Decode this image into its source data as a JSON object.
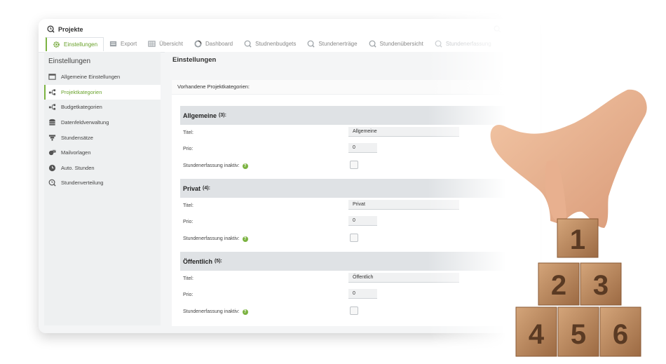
{
  "app": {
    "title": "Projekte"
  },
  "tabs": [
    {
      "label": "Einstellungen",
      "icon": "gear-icon",
      "active": true
    },
    {
      "label": "Export",
      "icon": "export-icon"
    },
    {
      "label": "Übersicht",
      "icon": "grid-icon"
    },
    {
      "label": "Dashboard",
      "icon": "dashboard-icon"
    },
    {
      "label": "Studnenbudgets",
      "icon": "clock-search-icon"
    },
    {
      "label": "Stundenerträge",
      "icon": "clock-search-icon"
    },
    {
      "label": "Stundenübersicht",
      "icon": "clock-search-icon"
    },
    {
      "label": "Stundenerfassung",
      "icon": "clock-search-icon"
    }
  ],
  "sidebar": {
    "title": "Einstellungen",
    "items": [
      {
        "label": "Allgemeine Einstellungen",
        "icon": "window-icon"
      },
      {
        "label": "Projektkategorien",
        "icon": "hierarchy-icon",
        "active": true
      },
      {
        "label": "Budgetkategorien",
        "icon": "hierarchy-icon"
      },
      {
        "label": "Datenfeldverwaltung",
        "icon": "database-icon"
      },
      {
        "label": "Stundensätze",
        "icon": "filter-icon"
      },
      {
        "label": "Mailvorlagen",
        "icon": "mail-icon"
      },
      {
        "label": "Auto. Stunden",
        "icon": "clock-icon"
      },
      {
        "label": "Stundenverteilung",
        "icon": "clock-search-icon"
      }
    ]
  },
  "main": {
    "title": "Einstellungen",
    "card_title": "Vorhandene Projektkategorien:",
    "labels": {
      "title": "Titel:",
      "prio": "Prio:",
      "inactive": "Stundenerfassung inaktiv:",
      "help": "?"
    },
    "categories": [
      {
        "name": "Allgemeine",
        "count": "(3):",
        "title_value": "Allgemeine",
        "prio_value": "0"
      },
      {
        "name": "Privat",
        "count": "(4):",
        "title_value": "Privat",
        "prio_value": "0"
      },
      {
        "name": "Öffentlich",
        "count": "(5):",
        "title_value": "Öffentlich",
        "prio_value": "0"
      }
    ]
  },
  "photo": {
    "blocks": [
      "1",
      "2",
      "3",
      "4",
      "5",
      "6"
    ]
  },
  "colors": {
    "accent": "#7cb342",
    "section_bg": "#dfe2e5",
    "block_wood": "#b7825a"
  }
}
